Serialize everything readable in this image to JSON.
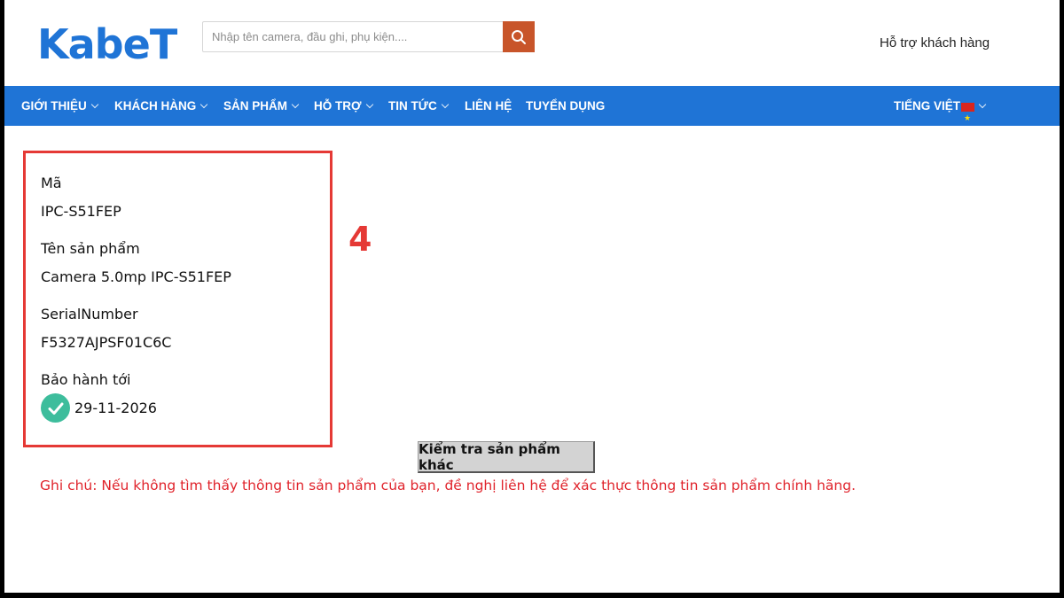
{
  "header": {
    "logo_text": "KabeT",
    "search_placeholder": "Nhập tên camera, đầu ghi, phụ kiện....",
    "support_label": "Hỗ trợ khách hàng"
  },
  "nav": {
    "items": [
      {
        "label": "GIỚI THIỆU",
        "has_dropdown": true
      },
      {
        "label": "KHÁCH HÀNG",
        "has_dropdown": true
      },
      {
        "label": "SẢN PHẨM",
        "has_dropdown": true
      },
      {
        "label": "HỖ TRỢ",
        "has_dropdown": true,
        "active": true
      },
      {
        "label": "TIN TỨC",
        "has_dropdown": true
      },
      {
        "label": "LIÊN HỆ",
        "has_dropdown": false
      },
      {
        "label": "TUYỂN DỤNG",
        "has_dropdown": false
      }
    ],
    "language_label": "TIẾNG VIỆT"
  },
  "result": {
    "code_label": "Mã",
    "code_value": "IPC-S51FEP",
    "name_label": "Tên sản phẩm",
    "name_value": "Camera 5.0mp IPC-S51FEP",
    "serial_label": "SerialNumber",
    "serial_value": "F5327AJPSF01C6C",
    "warranty_label": "Bảo hành tới",
    "warranty_value": "29-11-2026"
  },
  "annotation_number": "4",
  "check_other_button": "Kiểm tra sản phẩm khác",
  "note": "Ghi chú: Nếu không tìm thấy thông tin sản phẩm của bạn, đề nghị liên hệ để xác thực thông tin sản phẩm chính hãng.",
  "colors": {
    "brand_blue": "#1f74d6",
    "search_button": "#c8552a",
    "highlight_red": "#e53935",
    "check_green": "#3dbd9c"
  }
}
